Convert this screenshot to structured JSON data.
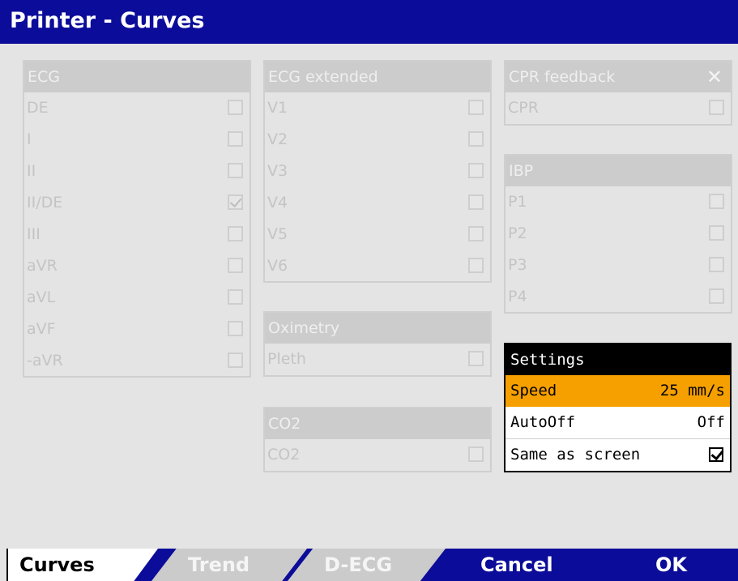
{
  "title": "Printer - Curves",
  "panels": {
    "ecg": {
      "header": "ECG",
      "rows": [
        {
          "label": "DE",
          "checked": false
        },
        {
          "label": "I",
          "checked": false
        },
        {
          "label": "II",
          "checked": false
        },
        {
          "label": "II/DE",
          "checked": true
        },
        {
          "label": "III",
          "checked": false
        },
        {
          "label": "aVR",
          "checked": false
        },
        {
          "label": "aVL",
          "checked": false
        },
        {
          "label": "aVF",
          "checked": false
        },
        {
          "label": "-aVR",
          "checked": false
        }
      ]
    },
    "ecg_extended": {
      "header": "ECG extended",
      "rows": [
        {
          "label": "V1",
          "checked": false
        },
        {
          "label": "V2",
          "checked": false
        },
        {
          "label": "V3",
          "checked": false
        },
        {
          "label": "V4",
          "checked": false
        },
        {
          "label": "V5",
          "checked": false
        },
        {
          "label": "V6",
          "checked": false
        }
      ]
    },
    "oximetry": {
      "header": "Oximetry",
      "rows": [
        {
          "label": "Pleth",
          "checked": false
        }
      ]
    },
    "co2": {
      "header": "CO2",
      "rows": [
        {
          "label": "CO2",
          "checked": false
        }
      ]
    },
    "cpr": {
      "header": "CPR feedback",
      "close_icon": "close-icon",
      "rows": [
        {
          "label": "CPR",
          "checked": false
        }
      ]
    },
    "ibp": {
      "header": "IBP",
      "rows": [
        {
          "label": "P1",
          "checked": false
        },
        {
          "label": "P2",
          "checked": false
        },
        {
          "label": "P3",
          "checked": false
        },
        {
          "label": "P4",
          "checked": false
        }
      ]
    }
  },
  "settings": {
    "header": "Settings",
    "speed_label": "Speed",
    "speed_value": "25 mm/s",
    "autooff_label": "AutoOff",
    "autooff_value": "Off",
    "same_label": "Same as screen",
    "same_checked": true
  },
  "tabs": {
    "curves": "Curves",
    "trend": "Trend",
    "decg": "D-ECG",
    "active": "Curves"
  },
  "softkeys": {
    "cancel": "Cancel",
    "ok": "OK"
  },
  "colors": {
    "title_bar": "#0c0c9a",
    "selected_row": "#f6a000",
    "background": "#e4e4e4"
  }
}
